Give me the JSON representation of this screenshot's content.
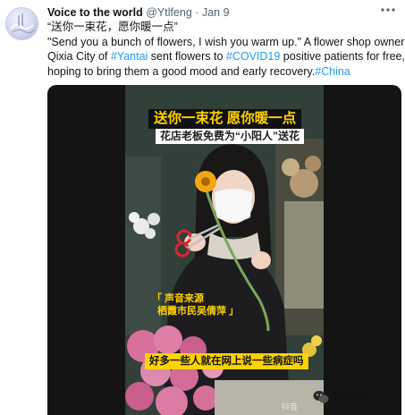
{
  "author": {
    "display_name": "Voice to the world",
    "handle": "@Ytlfeng",
    "separator": "·",
    "time": "Jan 9"
  },
  "tweet": {
    "line1": "“送你一束花，愿你暖一点”",
    "line2": "\"Send you a bunch of flowers, I wish you warm up.\" A flower shop owner in",
    "line3_pre": "Qixia City of ",
    "hashtag_yantai": "#Yantai",
    "line3_mid": " sent flowers to ",
    "hashtag_covid": "#COVID19",
    "line3_post": " positive patients for free,",
    "line4_pre": "hoping to bring them a good mood and early recovery.",
    "hashtag_china": "#China"
  },
  "video": {
    "caption_main": "送你一束花 愿你暖一点",
    "caption_sub": "花店老板免费为“小阳人”送花",
    "source_label": "「 声音来源",
    "source_name": "栖霞市民吴倩萍 」",
    "subtitle": "好多一些人就在网上说一些病症吗",
    "watermark": "烟台发布",
    "app_mark": "抖音"
  },
  "icons": {
    "more": "more-horizontal-icon",
    "wechat": "wechat-icon"
  },
  "colors": {
    "link": "#1d9bf0",
    "caption_yellow": "#ffd200",
    "secondary_text": "#536471"
  }
}
